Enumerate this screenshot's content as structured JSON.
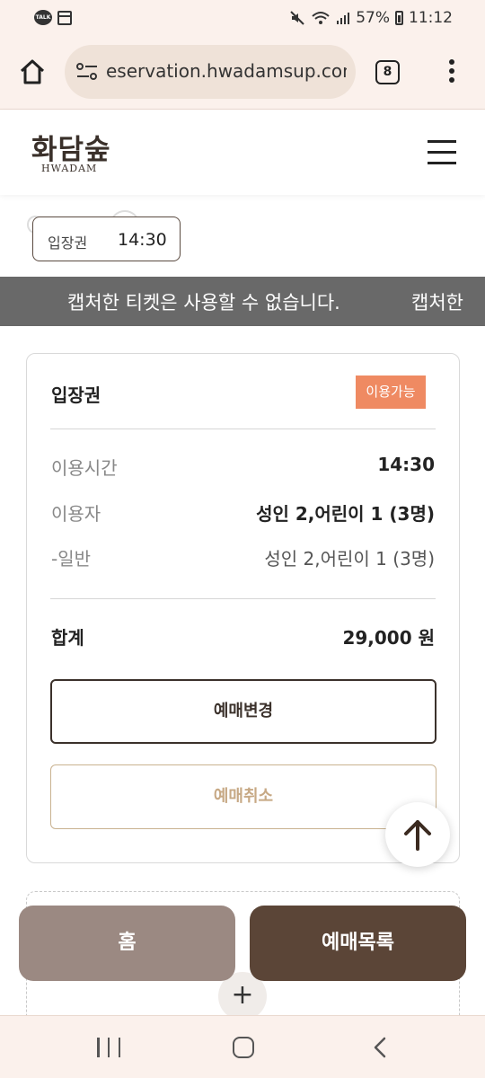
{
  "status_bar": {
    "time": "11:12",
    "battery": "57%",
    "left_icons": [
      "kakaotalk-icon",
      "calendar-icon"
    ],
    "talk_label": "TALK"
  },
  "browser": {
    "url": "reservation.hwadamsup.com",
    "url_visible": "eservation.hwadamsup.com",
    "tab_count": "8"
  },
  "site": {
    "logo_ko": "화담숲",
    "logo_en": "HWADAM"
  },
  "ticket_tag": {
    "label": "입장권",
    "time": "14:30"
  },
  "marquee": {
    "text": "캡처한 티켓은 사용할 수 없습니다.",
    "text_repeat": "캡처한"
  },
  "ticket": {
    "title": "입장권",
    "status_badge": "이용가능",
    "rows": [
      {
        "label": "이용시간",
        "value": "14:30"
      },
      {
        "label": "이용자",
        "value": "성인 2,어린이 1 (3명)"
      },
      {
        "label": "-일반",
        "value": "성인 2,어린이 1 (3명)"
      }
    ],
    "total_label": "합계",
    "total_value": "29,000 원",
    "change_label": "예매변경",
    "cancel_label": "예매취소"
  },
  "bottom": {
    "home_label": "홈",
    "list_label": "예매목록",
    "plus": "+"
  },
  "colors": {
    "accent_orange": "#ef8a62",
    "brown_dark": "#5b4537",
    "brown_light": "#9b8982",
    "marquee_bg": "#696969"
  }
}
